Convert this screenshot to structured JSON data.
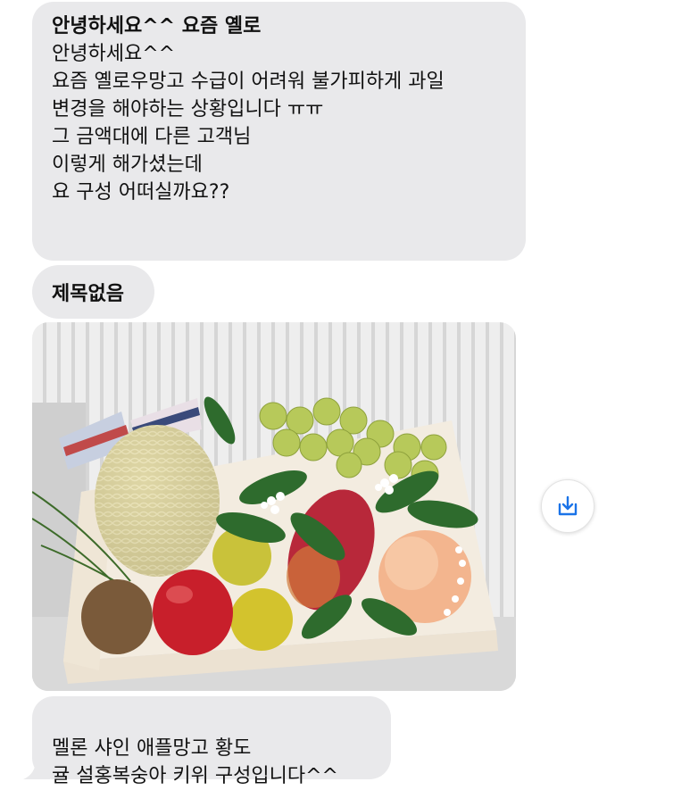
{
  "messages": [
    {
      "title": "안녕하세요^^ 요즘 옐로",
      "body": "안녕하세요^^\n요즘 옐로우망고 수급이 어려워 불가피하게 과일\n변경을 해야하는 상황입니다 ㅠㅠ\n그 금액대에 다른 고객님\n이렇게 해가셨는데\n요 구성 어떠실까요??"
    },
    {
      "title": "제목없음"
    },
    {
      "body": "멜론 샤인 애플망고 황도\n귤 설홍복숭아 키위 구성입니다^^"
    }
  ],
  "photo": {
    "subject": "fruit gift basket"
  },
  "icons": {
    "save": "download-save-icon"
  },
  "colors": {
    "bubble": "#e9e9eb",
    "accent": "#1a73e8"
  }
}
